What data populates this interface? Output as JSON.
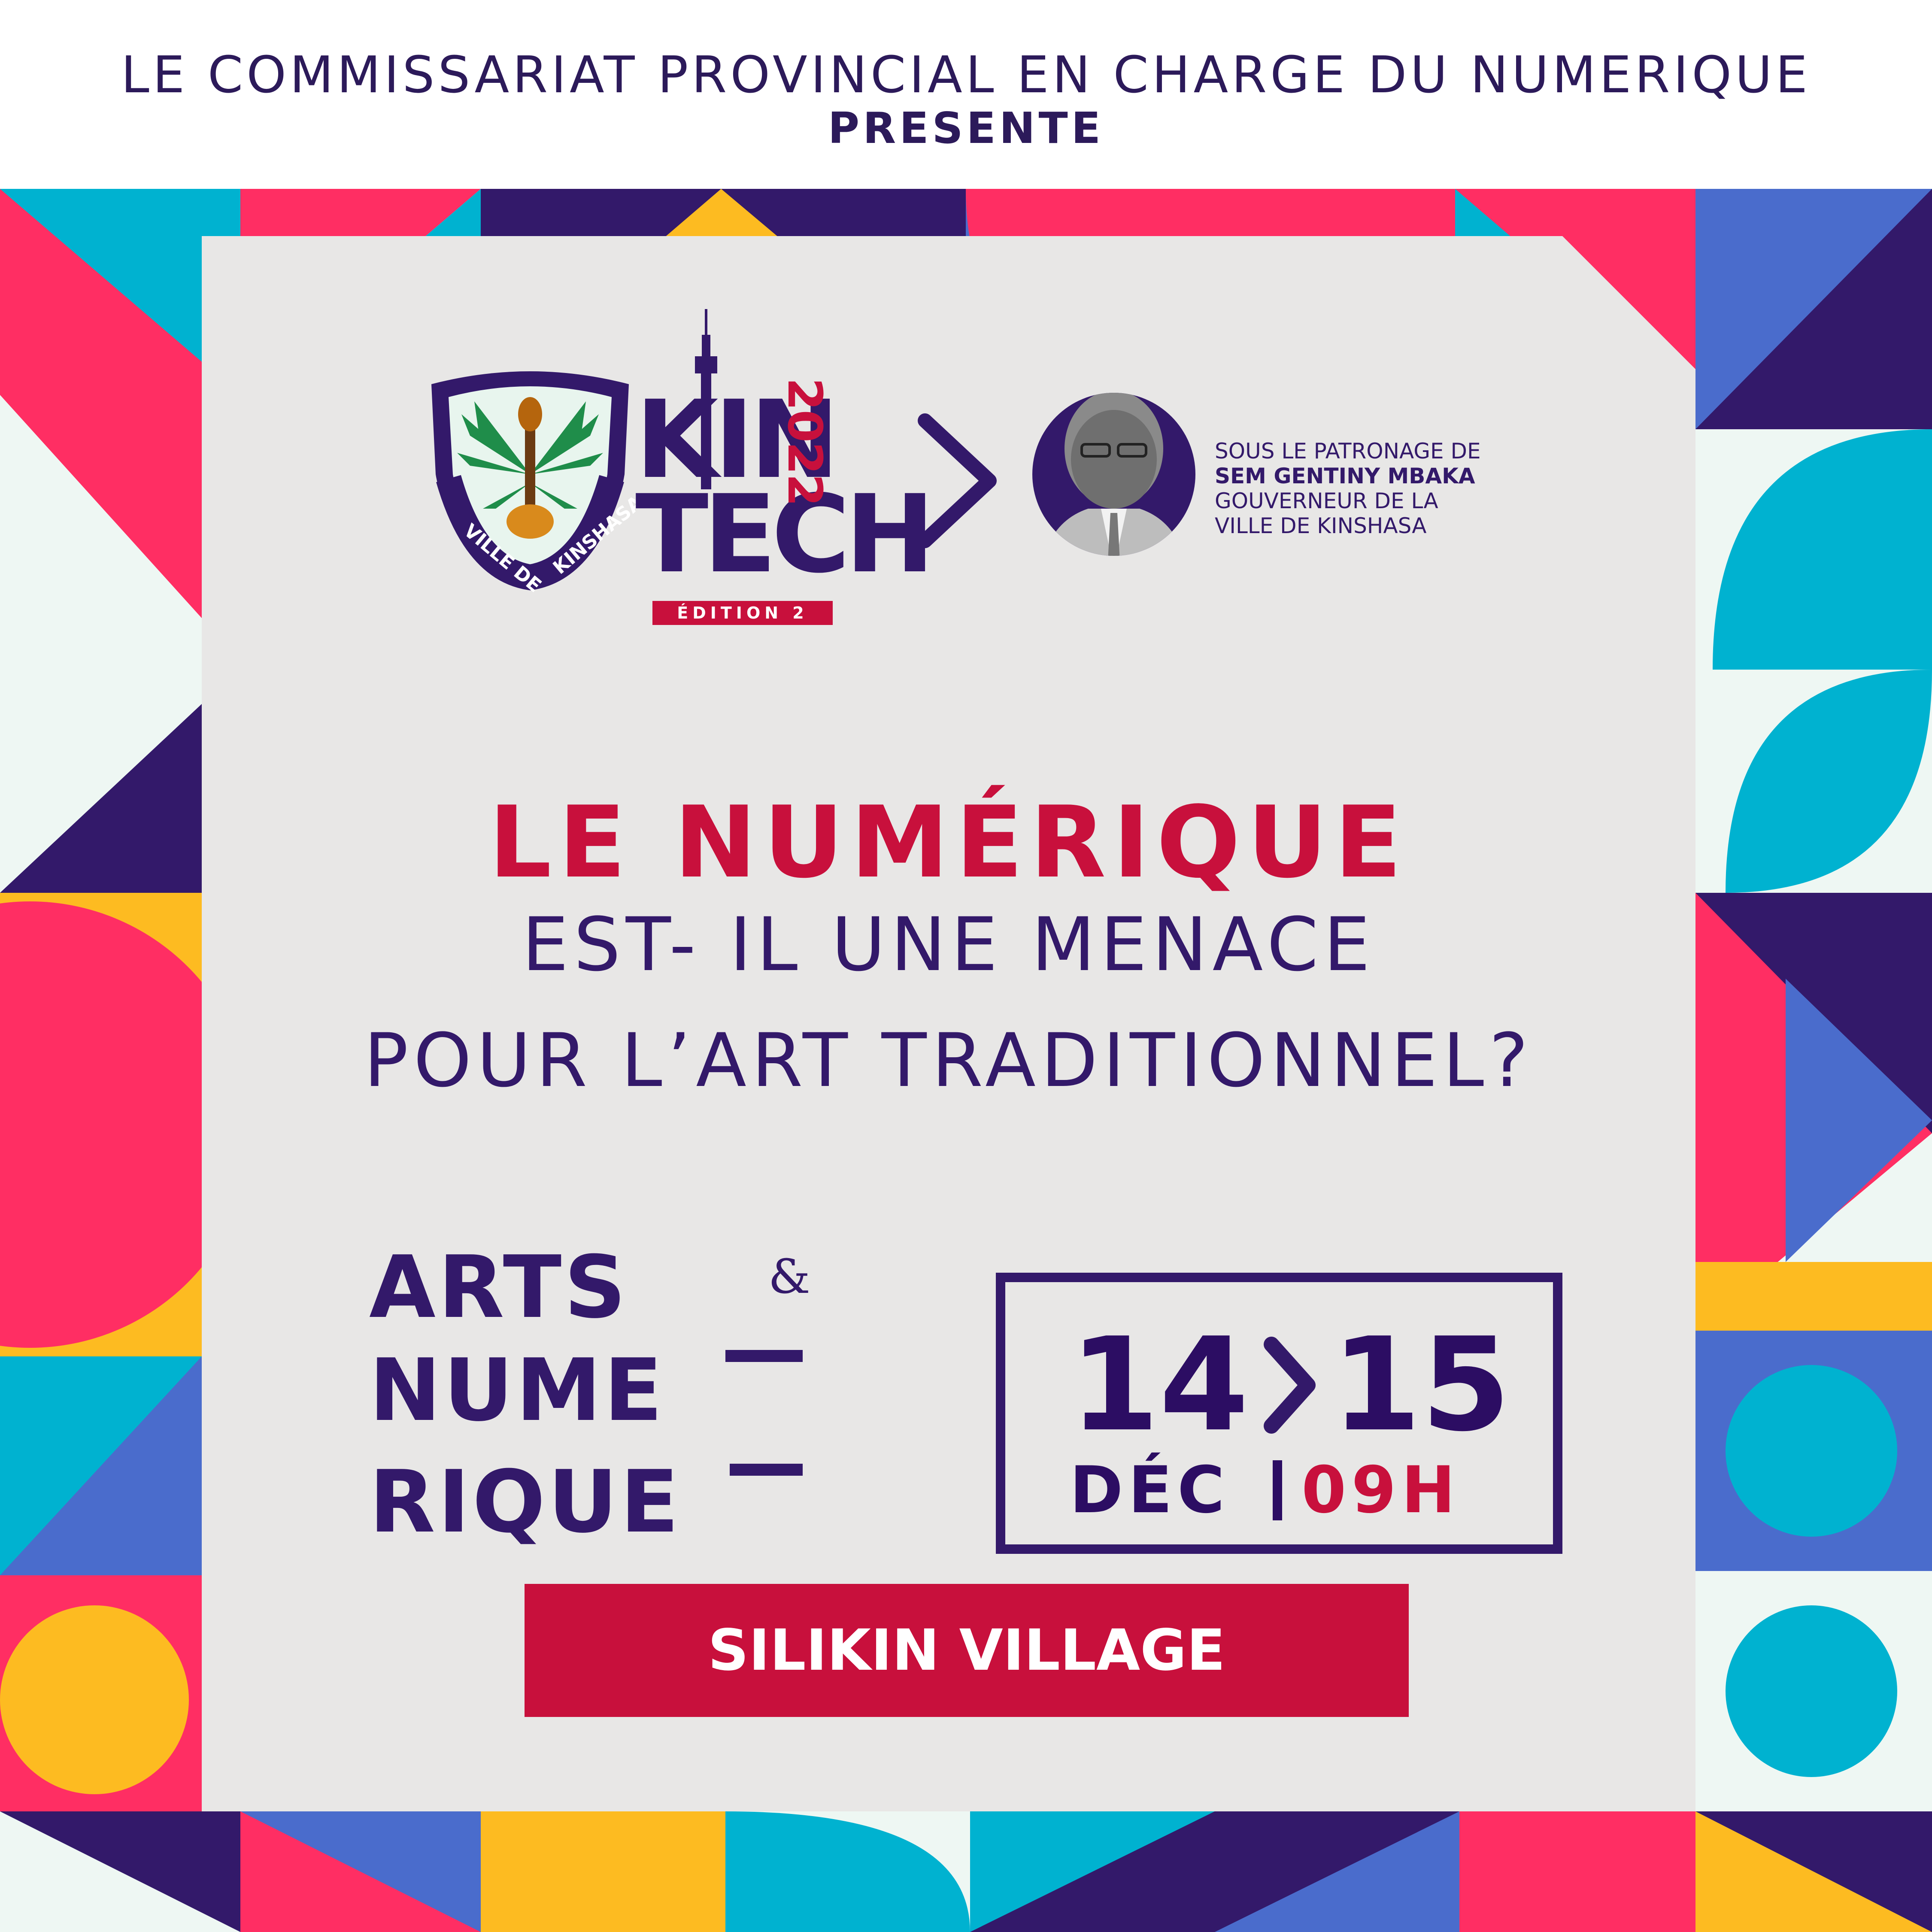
{
  "header": {
    "line1": "LE COMMISSARIAT PROVINCIAL EN CHARGE DU NUMERIQUE",
    "line2": "PRESENTE"
  },
  "logo_ville": {
    "text_left": "VILLE DE",
    "text_right": "KINSHASA"
  },
  "kintech": {
    "kin": "KIN",
    "tech": "TECH",
    "year": "2022",
    "edition": "ÉDITION 2"
  },
  "patron": {
    "line1": "SOUS LE PATRONAGE DE",
    "name": "SEM GENTINY MBAKA",
    "line3": "GOUVERNEUR DE LA",
    "line4": "VILLE DE KINSHASA"
  },
  "headline": {
    "line1": "LE NUMÉRIQUE",
    "line2": "EST- IL UNE MENACE",
    "line3": "POUR L’ART TRADITIONNEL?"
  },
  "arts_logo": {
    "arts": "ARTS",
    "amp": "&",
    "nume": "NUME",
    "rique": "RIQUE"
  },
  "date": {
    "start": "14",
    "end": "15",
    "month": "DÉC",
    "time": "09H"
  },
  "venue": "SILIKIN VILLAGE",
  "colors": {
    "navy": "#33196a",
    "red": "#c8103c",
    "pink": "#ff2e63",
    "yellow": "#fdbb21",
    "cyan": "#00b2d0",
    "blue": "#4a6ccc",
    "mint": "#eef7f3",
    "panel": "#e8e7e6"
  }
}
